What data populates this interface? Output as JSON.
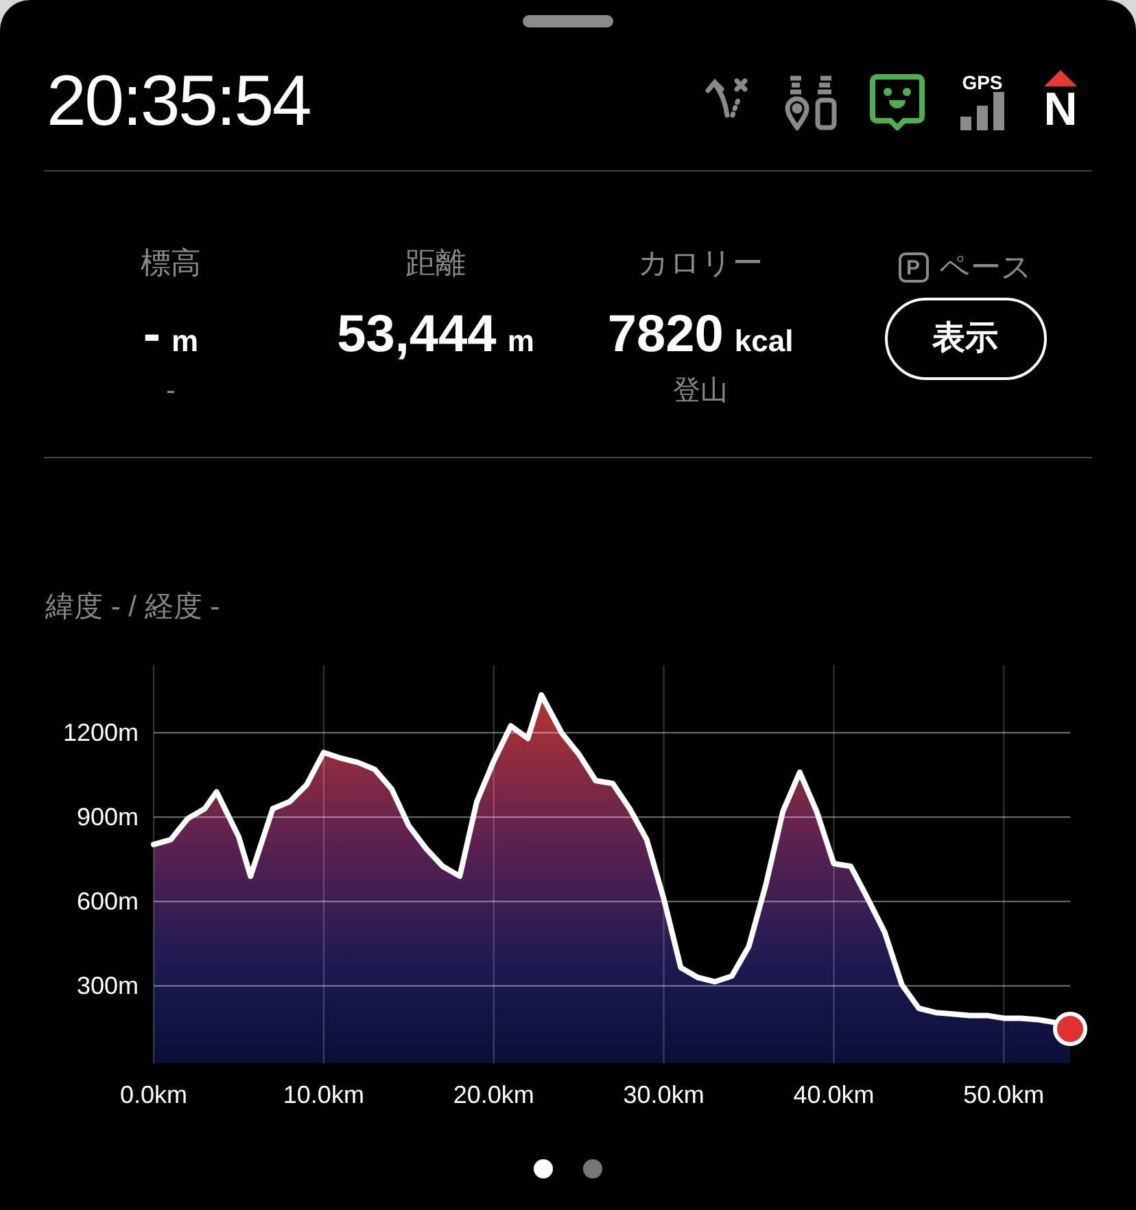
{
  "header": {
    "time": "20:35:54",
    "gps_label": "GPS",
    "compass_label": "N"
  },
  "stats": [
    {
      "label": "標高",
      "value": "-",
      "unit": "m",
      "sub": "-"
    },
    {
      "label": "距離",
      "value": "53,444",
      "unit": "m"
    },
    {
      "label": "カロリー",
      "value": "7820",
      "unit": "kcal",
      "sub": "登山"
    }
  ],
  "pace": {
    "icon_letter": "P",
    "label": "ペース",
    "button": "表示"
  },
  "location": "緯度 - / 経度 -",
  "elevation": {
    "chart_data": {
      "type": "area",
      "grid": true,
      "xlim": [
        0,
        53.9
      ],
      "ylim": [
        25,
        1440
      ],
      "xticks": [
        {
          "value": 0,
          "label": "0.0km"
        },
        {
          "value": 10,
          "label": "10.0km"
        },
        {
          "value": 20,
          "label": "20.0km"
        },
        {
          "value": 30,
          "label": "30.0km"
        },
        {
          "value": 40,
          "label": "40.0km"
        },
        {
          "value": 50,
          "label": "50.0km"
        }
      ],
      "yticks": [
        {
          "value": 300,
          "label": "300m"
        },
        {
          "value": 600,
          "label": "600m"
        },
        {
          "value": 900,
          "label": "900m"
        },
        {
          "value": 1200,
          "label": "1200m"
        }
      ],
      "x": [
        0,
        1,
        2,
        3,
        3.7,
        5,
        5.7,
        7,
        8,
        9,
        10,
        11,
        12,
        13,
        14,
        15,
        16,
        17,
        18,
        19,
        20,
        21,
        22,
        22.8,
        24,
        25,
        26,
        27,
        28,
        29,
        30,
        31,
        32,
        33,
        34,
        35,
        36,
        37,
        38,
        39,
        40,
        41,
        42,
        43,
        44,
        45,
        46,
        47,
        48,
        49,
        50,
        51,
        52,
        53,
        53.9
      ],
      "series": [
        {
          "color": "#ffffff",
          "values": [
            803,
            820,
            895,
            930,
            990,
            830,
            690,
            930,
            955,
            1015,
            1130,
            1110,
            1095,
            1070,
            1000,
            870,
            790,
            725,
            690,
            955,
            1100,
            1225,
            1180,
            1335,
            1200,
            1125,
            1030,
            1020,
            930,
            820,
            610,
            365,
            330,
            315,
            335,
            440,
            660,
            920,
            1060,
            920,
            735,
            725,
            610,
            490,
            305,
            220,
            205,
            200,
            195,
            195,
            185,
            185,
            180,
            170,
            147
          ]
        }
      ]
    }
  },
  "page_dots": [
    {
      "selected": true
    },
    {
      "selected": false
    }
  ]
}
